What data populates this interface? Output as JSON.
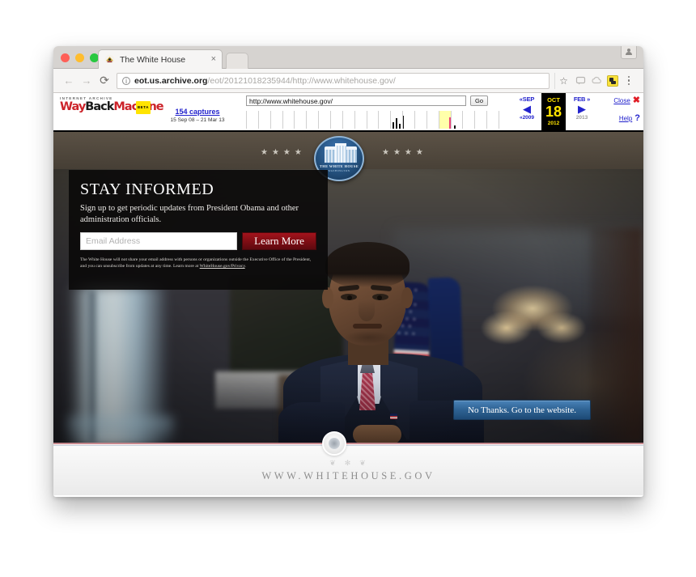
{
  "browser": {
    "tab": {
      "title": "The White House",
      "favicon": "white-house-seal-favicon",
      "close_label": "×"
    },
    "nav": {
      "back": "←",
      "forward": "→",
      "reload": "⟳"
    },
    "omnibox": {
      "info_icon": "ⓘ",
      "url_host": "eot.us.archive.org",
      "url_path": "/eot/20121018235944/http://www.whitehouse.gov/",
      "star_icon": "☆"
    },
    "toolbar_icons": [
      "comment-icon",
      "cloud-save-icon",
      "extension-icon",
      "overflow-menu-icon"
    ],
    "avatar_icon": "profile-avatar-icon"
  },
  "wayback": {
    "eyebrow": "INTERNET ARCHIVE",
    "wordmark_part1": "Way",
    "wordmark_part2": "Back",
    "wordmark_part3": "Machine",
    "beta_badge": "BETA",
    "captures_count": "154 captures",
    "captures_range": "15 Sep 08 – 21 Mar 13",
    "url_value": "http://www.whitehouse.gov/",
    "go_label": "Go",
    "date_nav": {
      "prev_month": "«SEP",
      "prev_arrow": "◀",
      "prev_year": "«2009",
      "current_month": "OCT",
      "current_day": "18",
      "current_year": "2012",
      "next_month": "FEB »",
      "next_arrow": "▶",
      "next_year": "2013"
    },
    "close_label": "Close",
    "close_icon": "✖",
    "help_label": "Help",
    "help_icon": "?",
    "timeline_cells": [
      {
        "active": false,
        "bars": []
      },
      {
        "active": false,
        "bars": []
      },
      {
        "active": false,
        "bars": []
      },
      {
        "active": false,
        "bars": []
      },
      {
        "active": false,
        "bars": []
      },
      {
        "active": false,
        "bars": []
      },
      {
        "active": false,
        "bars": []
      },
      {
        "active": false,
        "bars": []
      },
      {
        "active": false,
        "bars": []
      },
      {
        "active": false,
        "bars": []
      },
      {
        "active": false,
        "bars": []
      },
      {
        "active": false,
        "bars": []
      },
      {
        "active": false,
        "bars": [
          {
            "h": 8,
            "x": 2
          },
          {
            "h": 13,
            "x": 6
          },
          {
            "h": 6,
            "x": 10
          },
          {
            "h": 16,
            "x": 14
          }
        ]
      },
      {
        "active": false,
        "bars": []
      },
      {
        "active": false,
        "bars": []
      },
      {
        "active": false,
        "bars": []
      },
      {
        "active": true,
        "bars": [
          {
            "h": 14,
            "x": 12,
            "color": "pink"
          },
          {
            "h": 4,
            "x": 18
          }
        ]
      },
      {
        "active": false,
        "bars": []
      },
      {
        "active": false,
        "bars": []
      },
      {
        "active": false,
        "bars": []
      },
      {
        "active": false,
        "bars": []
      },
      {
        "active": false,
        "bars": []
      }
    ]
  },
  "page": {
    "header": {
      "stars_left": "★★★★",
      "stars_right": "★★★★",
      "seal_line1": "THE WHITE HOUSE",
      "seal_line2": "WASHINGTON"
    },
    "overlay": {
      "title": "STAY INFORMED",
      "subtitle": "Sign up to get periodic updates from President Obama and other administration officials.",
      "email_placeholder": "Email Address",
      "email_value": "",
      "cta_label": "Learn More",
      "legal_text": "The White House will not share your email address with persons or organizations outside the Executive Office of the President, and you can unsubscribe from updates at any time. Learn more at ",
      "legal_link": "WhiteHouse.gov/Privacy",
      "legal_tail": "."
    },
    "no_thanks_label": "No Thanks. Go to the website.",
    "footer": {
      "flourish": "❦  ✻  ❦",
      "url": "WWW.WHITEHOUSE.GOV"
    }
  },
  "colors": {
    "accent_red": "#a3131c",
    "accent_blue": "#2f6394",
    "wayback_link": "#2222cc",
    "wayback_highlight": "#ffe400",
    "seal_blue": "#25527f"
  }
}
